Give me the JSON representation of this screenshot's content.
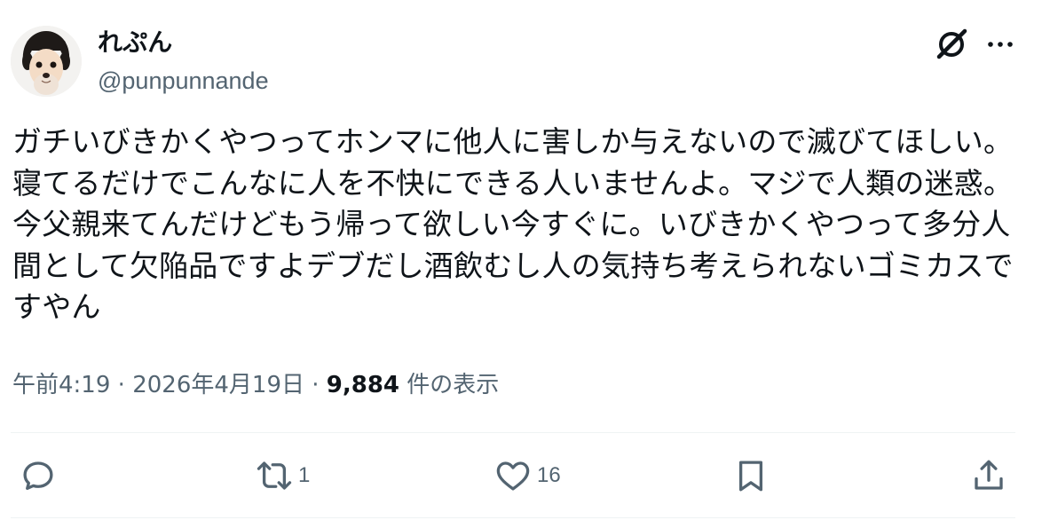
{
  "author": {
    "display_name": "れぷん",
    "handle": "@punpunnande"
  },
  "tweet": {
    "text": "ガチいびきかくやつってホンマに他人に害しか与えないので滅びてほしい。寝てるだけでこんなに人を不快にできる人いませんよ。マジで人類の迷惑。今父親来てんだけどもう帰って欲しい今すぐに。いびきかくやつって多分人間として欠陥品ですよデブだし酒飲むし人の気持ち考えられないゴミカスですやん"
  },
  "meta": {
    "time": "午前4:19",
    "separator": " · ",
    "date": "2026年4月19日",
    "views_count": "9,884",
    "views_label": " 件の表示"
  },
  "actions": {
    "reply_count": "",
    "retweet_count": "1",
    "like_count": "16"
  },
  "icons": [
    "grok-icon",
    "more-icon",
    "reply-icon",
    "retweet-icon",
    "like-icon",
    "bookmark-icon",
    "share-icon"
  ],
  "colors": {
    "text": "#0f1419",
    "secondary": "#536471",
    "divider": "#eff3f4"
  }
}
